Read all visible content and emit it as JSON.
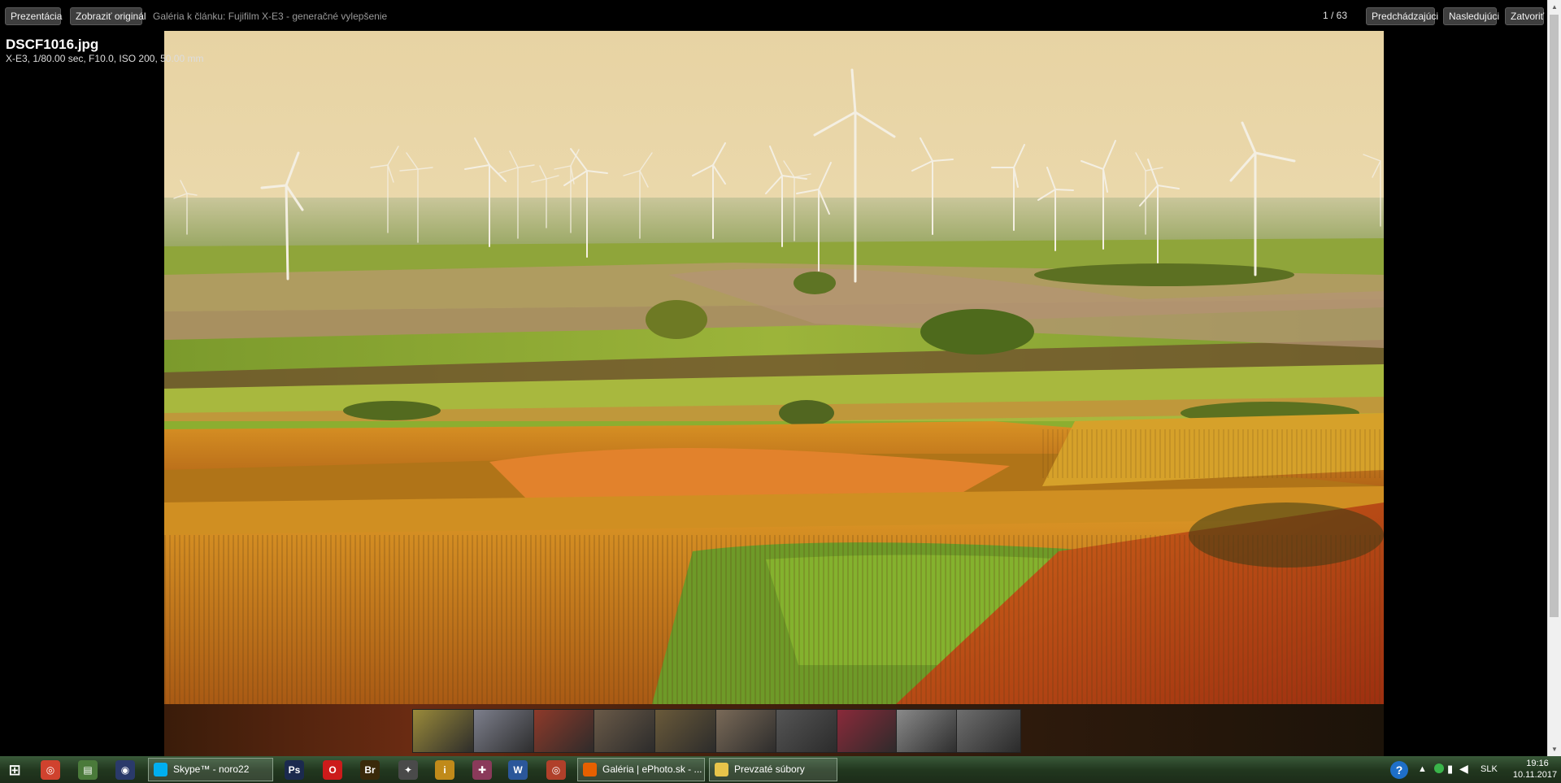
{
  "toolbar": {
    "presentation_label": "Prezentácia",
    "original_label": "Zobraziť originál",
    "gallery_title": "Galéria k článku: Fujifilm X-E3 - generačné vylepšenie",
    "counter": "1 / 63",
    "prev_label": "Predchádzajúci",
    "next_label": "Nasledujúci",
    "close_label": "Zatvoriť"
  },
  "photo": {
    "filename": "DSCF1016.jpg",
    "exif": "X-E3, 1/80.00 sec, F10.0, ISO 200, 50.00 mm"
  },
  "thumbnails": [
    {
      "icon": "landscape-thumbnail",
      "color": "#9a8a3a"
    },
    {
      "icon": "fabric-thumbnail",
      "color": "#7d7f8c"
    },
    {
      "icon": "red-leaves-thumbnail",
      "color": "#8e3a2a"
    },
    {
      "icon": "bark-thumbnail",
      "color": "#6a5a48"
    },
    {
      "icon": "leaf-thumbnail",
      "color": "#6a5a3a"
    },
    {
      "icon": "grapes-thumbnail",
      "color": "#7a6a58"
    },
    {
      "icon": "grapes-bw-thumbnail",
      "color": "#555555"
    },
    {
      "icon": "berries-thumbnail",
      "color": "#8a2a3a"
    },
    {
      "icon": "statue-thumbnail",
      "color": "#8a8a8a"
    },
    {
      "icon": "statue-bw-thumbnail",
      "color": "#6e6e6e"
    }
  ],
  "taskbar": {
    "tasks": [
      {
        "label": "Skype™ - noro22",
        "icon": "skype-icon",
        "color": "#00aff0"
      },
      {
        "label": "Galéria | ePhoto.sk - ...",
        "icon": "firefox-icon",
        "color": "#e66000"
      },
      {
        "label": "Prevzaté súbory",
        "icon": "folder-icon",
        "color": "#e8c44a"
      }
    ],
    "pinned": [
      {
        "icon": "chrome-icon",
        "glyph": "◎",
        "color": "#d0422e"
      },
      {
        "icon": "file-manager-icon",
        "glyph": "▤",
        "color": "#4a7a3a"
      },
      {
        "icon": "app-icon",
        "glyph": "◉",
        "color": "#2a3a6a"
      },
      {
        "icon": "photoshop-icon",
        "glyph": "Ps",
        "color": "#1b2a4e"
      },
      {
        "icon": "opera-icon",
        "glyph": "O",
        "color": "#cc1b1b"
      },
      {
        "icon": "bridge-icon",
        "glyph": "Br",
        "color": "#3a2a0a"
      },
      {
        "icon": "game-icon",
        "glyph": "✦",
        "color": "#4a4a4a"
      },
      {
        "icon": "info-icon",
        "glyph": "i",
        "color": "#c08a1a"
      },
      {
        "icon": "network-icon",
        "glyph": "✚",
        "color": "#8a3a5a"
      },
      {
        "icon": "word-icon",
        "glyph": "W",
        "color": "#2b579a"
      },
      {
        "icon": "target-icon",
        "glyph": "◎",
        "color": "#b0402a"
      }
    ],
    "language": "SLK",
    "time": "19:16",
    "date": "10.11.2017"
  }
}
